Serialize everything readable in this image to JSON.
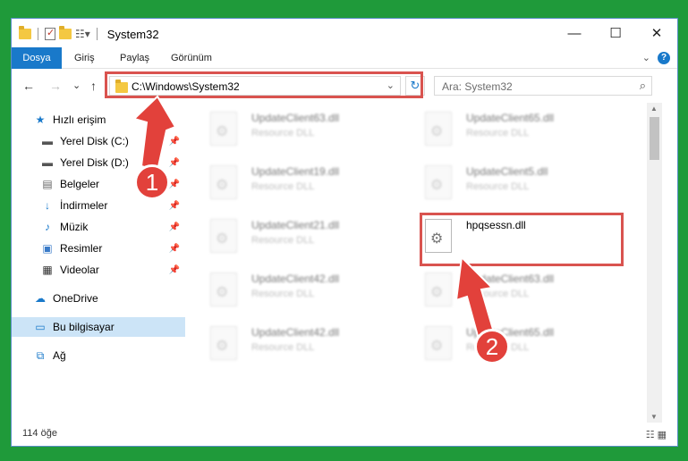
{
  "window": {
    "title": "System32",
    "minimize_glyph": "—",
    "maximize_glyph": "☐",
    "close_glyph": "✕"
  },
  "ribbon": {
    "tabs": [
      "Dosya",
      "Giriş",
      "Paylaş",
      "Görünüm"
    ],
    "expand_glyph": "⌄",
    "help_glyph": "?"
  },
  "navigation": {
    "back_glyph": "←",
    "forward_glyph": "→",
    "recent_glyph": "⌄",
    "up_glyph": "↑",
    "address": "C:\\Windows\\System32",
    "address_dropdown_glyph": "⌄",
    "refresh_glyph": "↻",
    "search_placeholder": "Ara: System32",
    "search_glyph": "⌕"
  },
  "sidebar": {
    "items": [
      {
        "label": "Hızlı erişim",
        "icon": "star-icon",
        "pinned": false
      },
      {
        "label": "Yerel Disk (C:)",
        "icon": "drive-icon",
        "pinned": true
      },
      {
        "label": "Yerel Disk (D:)",
        "icon": "drive-icon",
        "pinned": true
      },
      {
        "label": "Belgeler",
        "icon": "documents-icon",
        "pinned": true
      },
      {
        "label": "İndirmeler",
        "icon": "download-icon",
        "pinned": true
      },
      {
        "label": "Müzik",
        "icon": "music-icon",
        "pinned": true
      },
      {
        "label": "Resimler",
        "icon": "pictures-icon",
        "pinned": true
      },
      {
        "label": "Videolar",
        "icon": "videos-icon",
        "pinned": true
      },
      {
        "label": "OneDrive",
        "icon": "cloud-icon",
        "pinned": false
      },
      {
        "label": "Bu bilgisayar",
        "icon": "computer-icon",
        "pinned": false,
        "selected": true
      },
      {
        "label": "Ağ",
        "icon": "network-icon",
        "pinned": false
      }
    ]
  },
  "files": [
    {
      "name": "UpdateClient63.dll",
      "desc": "Resource DLL",
      "blurred": true
    },
    {
      "name": "UpdateClient65.dll",
      "desc": "Resource DLL",
      "blurred": true
    },
    {
      "name": "UpdateClient19.dll",
      "desc": "Resource DLL",
      "blurred": true
    },
    {
      "name": "UpdateClient5.dll",
      "desc": "Resource DLL",
      "blurred": true
    },
    {
      "name": "UpdateClient21.dll",
      "desc": "Resource DLL",
      "blurred": true
    },
    {
      "name": "hpqsessn.dll",
      "desc": "",
      "blurred": false,
      "highlighted": true
    },
    {
      "name": "UpdateClient42.dll",
      "desc": "Resource DLL",
      "blurred": true
    },
    {
      "name": "UpdateClient63.dll",
      "desc": "Resource DLL",
      "blurred": true
    },
    {
      "name": "UpdateClient42.dll",
      "desc": "Resource DLL",
      "blurred": true
    },
    {
      "name": "UpdateClient65.dll",
      "desc": "Resource DLL",
      "blurred": true
    }
  ],
  "status": {
    "item_count": "114 öğe",
    "view_glyphs": "☷ ▦"
  },
  "annotations": {
    "step1": "1",
    "step2": "2",
    "accent_color": "#e2413b"
  }
}
